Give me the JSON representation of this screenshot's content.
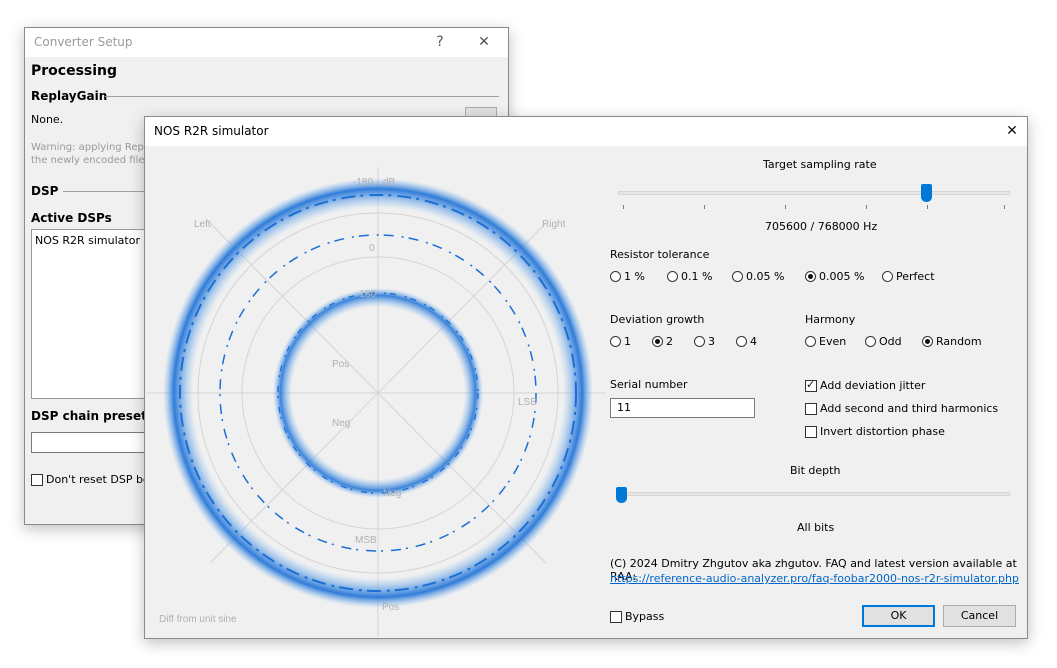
{
  "converter_setup": {
    "title": "Converter Setup",
    "help_glyph": "?",
    "close_glyph": "✕",
    "processing_heading": "Processing",
    "replaygain_heading": "ReplayGain",
    "replaygain_value": "None.",
    "warning_line1": "Warning: applying Replay",
    "warning_line2": "the newly encoded file,",
    "dsp_heading": "DSP",
    "active_dsps_label": "Active DSPs",
    "active_dsps_items": [
      "NOS R2R simulator"
    ],
    "chain_presets_label": "DSP chain presets",
    "dont_reset_label": "Don't reset DSP betw"
  },
  "nos_dialog": {
    "title": "NOS R2R simulator",
    "close_glyph": "✕",
    "target_rate_label": "Target sampling rate",
    "target_rate_value": "705600 / 768000 Hz",
    "target_rate_position": 0.79,
    "resistor_tolerance_label": "Resistor tolerance",
    "resistor_options": [
      "1 %",
      "0.1 %",
      "0.05 %",
      "0.005 %",
      "Perfect"
    ],
    "resistor_selected": 3,
    "deviation_growth_label": "Deviation growth",
    "deviation_options": [
      "1",
      "2",
      "3",
      "4"
    ],
    "deviation_selected": 1,
    "harmony_label": "Harmony",
    "harmony_options": [
      "Even",
      "Odd",
      "Random"
    ],
    "harmony_selected": 2,
    "serial_label": "Serial number",
    "serial_value": "11",
    "add_jitter_label": "Add deviation jitter",
    "add_jitter_checked": true,
    "add_harmonics_label": "Add second and third harmonics",
    "add_harmonics_checked": false,
    "invert_phase_label": "Invert distortion phase",
    "invert_phase_checked": false,
    "bit_depth_label": "Bit depth",
    "bit_depth_value": "All bits",
    "bit_depth_position": 0.0,
    "credit_text": "(C) 2024 Dmitry Zhgutov aka zhgutov. FAQ and latest version available at RAA:",
    "credit_link": "https://reference-audio-analyzer.pro/faq-foobar2000-nos-r2r-simulator.php",
    "bypass_label": "Bypass",
    "bypass_checked": false,
    "ok_label": "OK",
    "cancel_label": "Cancel",
    "plot": {
      "labels": {
        "top_scale": "-180",
        "db": "dB",
        "left": "Left",
        "right": "Right",
        "zero": "0",
        "inner_scale": "-180",
        "pos_upper": "Pos",
        "neg_upper": "Neg",
        "lsb": "LSB",
        "neg_lower": "Neg",
        "msb": "MSB",
        "pos_lower": "Pos",
        "diff_caption": "Diff from unit sine"
      },
      "colors": {
        "trace": "#1a6fd6",
        "glow": "#6fb0f0",
        "axis": "#d4d4d4"
      }
    }
  }
}
